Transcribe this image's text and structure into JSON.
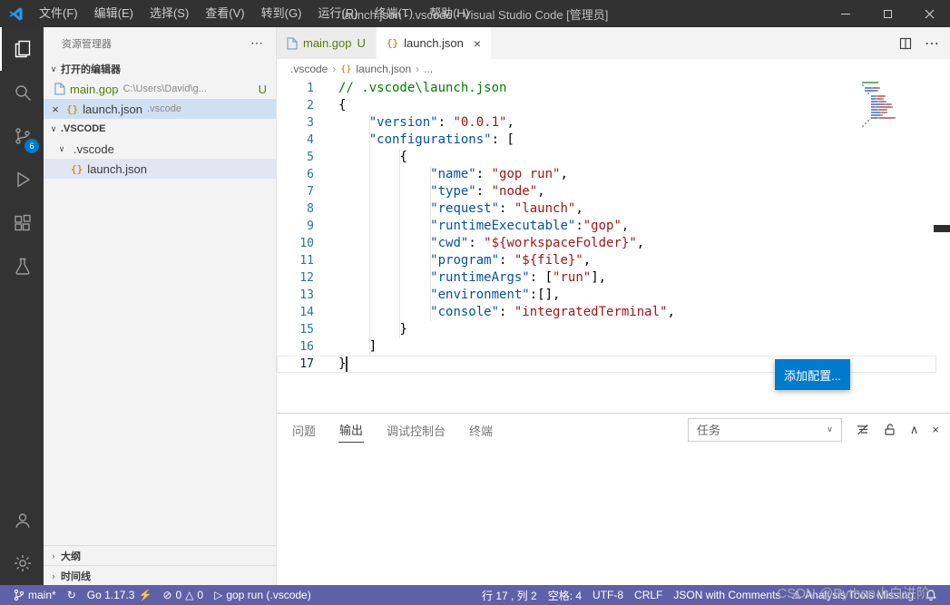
{
  "icons": {
    "chevron_down": "∨",
    "chevron_right": "›",
    "chevron_up": "∧",
    "more": "⋯",
    "close": "×",
    "braces": "{}",
    "sync": "↻",
    "error": "⊘",
    "warning": "△",
    "play": "▷",
    "alert": "⚠",
    "zap": "⚡",
    "dropdown": "∨"
  },
  "title_bar": {
    "menus": [
      "文件(F)",
      "编辑(E)",
      "选择(S)",
      "查看(V)",
      "转到(G)",
      "运行(R)",
      "终端(T)",
      "帮助(H)"
    ],
    "title": "launch.json - .vscode - Visual Studio Code [管理员]"
  },
  "activity_bar": {
    "scm_badge": "6"
  },
  "sidebar": {
    "header": "资源管理器",
    "open_editors": {
      "label": "打开的编辑器",
      "items": [
        {
          "name": "main.gop",
          "desc": "C:\\Users\\David\\g...",
          "badge": "U"
        },
        {
          "name": "launch.json",
          "desc": ".vscode"
        }
      ]
    },
    "workspace": {
      "label": ".VSCODE",
      "folder": ".vscode",
      "file": "launch.json"
    },
    "outline_label": "大纲",
    "timeline_label": "时间线"
  },
  "editor": {
    "tabs": [
      {
        "label": "main.gop",
        "badge": "U"
      },
      {
        "label": "launch.json"
      }
    ],
    "breadcrumb": {
      "folder": ".vscode",
      "file": "launch.json",
      "more": "..."
    },
    "active_line": "17",
    "add_config_label": "添加配置...",
    "code": [
      {
        "n": "1",
        "t": [
          [
            "c",
            "// .vscode\\launch.json"
          ]
        ]
      },
      {
        "n": "2",
        "t": [
          [
            "p",
            "{"
          ]
        ]
      },
      {
        "n": "3",
        "t": [
          [
            "w",
            "    "
          ],
          [
            "k",
            "\"version\""
          ],
          [
            "p",
            ": "
          ],
          [
            "s",
            "\"0.0.1\""
          ],
          [
            "p",
            ","
          ]
        ]
      },
      {
        "n": "4",
        "t": [
          [
            "w",
            "    "
          ],
          [
            "k",
            "\"configurations\""
          ],
          [
            "p",
            ": ["
          ]
        ]
      },
      {
        "n": "5",
        "t": [
          [
            "w",
            "        "
          ],
          [
            "p",
            "{"
          ]
        ]
      },
      {
        "n": "6",
        "t": [
          [
            "w",
            "            "
          ],
          [
            "k",
            "\"name\""
          ],
          [
            "p",
            ": "
          ],
          [
            "s",
            "\"gop run\""
          ],
          [
            "p",
            ","
          ]
        ]
      },
      {
        "n": "7",
        "t": [
          [
            "w",
            "            "
          ],
          [
            "k",
            "\"type\""
          ],
          [
            "p",
            ": "
          ],
          [
            "s",
            "\"node\""
          ],
          [
            "p",
            ","
          ]
        ]
      },
      {
        "n": "8",
        "t": [
          [
            "w",
            "            "
          ],
          [
            "k",
            "\"request\""
          ],
          [
            "p",
            ": "
          ],
          [
            "s",
            "\"launch\""
          ],
          [
            "p",
            ","
          ]
        ]
      },
      {
        "n": "9",
        "t": [
          [
            "w",
            "            "
          ],
          [
            "k",
            "\"runtimeExecutable\""
          ],
          [
            "p",
            ":"
          ],
          [
            "s",
            "\"gop\""
          ],
          [
            "p",
            ","
          ]
        ]
      },
      {
        "n": "10",
        "t": [
          [
            "w",
            "            "
          ],
          [
            "k",
            "\"cwd\""
          ],
          [
            "p",
            ": "
          ],
          [
            "s",
            "\"${workspaceFolder}\""
          ],
          [
            "p",
            ","
          ]
        ]
      },
      {
        "n": "11",
        "t": [
          [
            "w",
            "            "
          ],
          [
            "k",
            "\"program\""
          ],
          [
            "p",
            ": "
          ],
          [
            "s",
            "\"${file}\""
          ],
          [
            "p",
            ","
          ]
        ]
      },
      {
        "n": "12",
        "t": [
          [
            "w",
            "            "
          ],
          [
            "k",
            "\"runtimeArgs\""
          ],
          [
            "p",
            ": ["
          ],
          [
            "s",
            "\"run\""
          ],
          [
            "p",
            "],"
          ]
        ]
      },
      {
        "n": "13",
        "t": [
          [
            "w",
            "            "
          ],
          [
            "k",
            "\"environment\""
          ],
          [
            "p",
            ":[],"
          ]
        ]
      },
      {
        "n": "14",
        "t": [
          [
            "w",
            "            "
          ],
          [
            "k",
            "\"console\""
          ],
          [
            "p",
            ": "
          ],
          [
            "s",
            "\"integratedTerminal\""
          ],
          [
            "p",
            ","
          ]
        ]
      },
      {
        "n": "15",
        "t": [
          [
            "w",
            "        "
          ],
          [
            "p",
            "}"
          ]
        ]
      },
      {
        "n": "16",
        "t": [
          [
            "w",
            "    "
          ],
          [
            "p",
            "]"
          ]
        ]
      },
      {
        "n": "17",
        "t": [
          [
            "p",
            "}"
          ]
        ]
      }
    ]
  },
  "panel": {
    "tabs": [
      "问题",
      "输出",
      "调试控制台",
      "终端"
    ],
    "channel_select": "任务"
  },
  "status_bar": {
    "branch": "main*",
    "go": "Go 1.17.3",
    "errors": "0",
    "warnings": "0",
    "run": "gop run (.vscode)",
    "line_col": "行 17 , 列 2",
    "indent": "空格: 4",
    "encoding": "UTF-8",
    "eol": "CRLF",
    "language": "JSON with Comments",
    "analysis": "Analysis Tools Missing"
  },
  "watermark": "CSDN @Python小白进阶"
}
